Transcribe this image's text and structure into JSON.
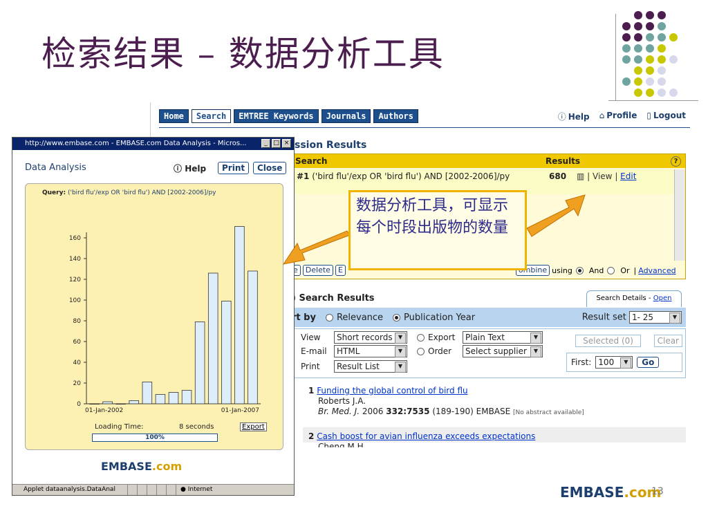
{
  "slide": {
    "title": "检索结果 – 数据分析工具",
    "callout": "数据分析工具，可显示每个时段出版物的数量",
    "brand_logo": {
      "main": "EMBASE",
      "suffix": ".com"
    },
    "page_number": "13",
    "colors": {
      "title": "#4b1e4f",
      "accent_orange": "#f0a020",
      "purple": "#4b1e4f",
      "teal": "#6fa4a0",
      "lime": "#c8c800",
      "lavender": "#d8d8ec"
    }
  },
  "main_page": {
    "nav_buttons": [
      "Home",
      "Search",
      "EMTREE Keywords",
      "Journals",
      "Authors"
    ],
    "active_nav": "Search",
    "top_links": [
      {
        "icon": "help-icon",
        "label": "Help"
      },
      {
        "icon": "profile-icon",
        "label": "Profile"
      },
      {
        "icon": "logout-icon",
        "label": "Logout"
      }
    ],
    "session_title": "ssion Results",
    "history": {
      "head_search": "Search",
      "head_results": "Results",
      "row_query_prefix": "#1",
      "row_query": "('bird flu'/exp OR 'bird flu') AND [2002-2006]/py",
      "row_count": "680",
      "row_view": "View",
      "row_edit": "Edit",
      "buttons": [
        "e",
        "Delete",
        "E",
        "ombine"
      ],
      "using_label": "using",
      "and_label": "And",
      "or_label": "Or",
      "advanced_label": "Advanced"
    },
    "results_title": ") Search Results",
    "search_details": {
      "label": "Search Details -",
      "link": "Open"
    },
    "sort": {
      "label": "rt by",
      "relevance": "Relevance",
      "pub_year": "Publication Year",
      "result_set_label": "Result set",
      "result_set_value": "1- 25"
    },
    "options": {
      "view_label": "View",
      "view_value": "Short records",
      "email_label": "E-mail",
      "email_value": "HTML",
      "print_label": "Print",
      "print_value": "Result List",
      "export_label": "Export",
      "export_value": "Plain Text",
      "order_label": "Order",
      "order_value": "Select supplier",
      "selected_label": "Selected (0)",
      "clear_label": "Clear",
      "first_label": "First:",
      "first_value": "100",
      "go_label": "Go"
    },
    "records": [
      {
        "num": "1",
        "title": "Funding the global control of bird flu",
        "authors": "Roberts J.A.",
        "journal": "Br. Med. J.",
        "year": "2006",
        "volume": "332:7535",
        "pages": "(189-190) EMBASE",
        "note": "[No abstract available]"
      },
      {
        "num": "2",
        "title": "Cash boost for avian influenza exceeds expectations",
        "authors": "Cheng M.H."
      }
    ]
  },
  "popup": {
    "window_title": "http://www.embase.com - EMBASE.com Data Analysis - Micros...",
    "heading": "Data Analysis",
    "help_label": "Help",
    "print_label": "Print",
    "close_label": "Close",
    "query_label": "Query:",
    "query_text": "('bird flu'/exp OR 'bird flu') AND [2002-2006]/py",
    "loading_label": "Loading Time:",
    "loading_value": "8 seconds",
    "export_label": "Export",
    "progress_label": "100%",
    "progress_value": 1.0,
    "logo_main": "EMBASE",
    "logo_suffix": ".com",
    "status_text": "Applet dataanalysis.DataAnal",
    "status_zone": "Internet"
  },
  "chart_data": {
    "type": "bar",
    "values": [
      0,
      2,
      0,
      3,
      21,
      9,
      11,
      13,
      79,
      126,
      99,
      171,
      128
    ],
    "ylim": [
      0,
      180
    ],
    "yticks": [
      0,
      20,
      40,
      60,
      80,
      100,
      120,
      140,
      160
    ],
    "x_tick_labels": [
      "01-Jan-2002",
      "01-Jan-2007"
    ],
    "grid": false,
    "bar_color": "#ddeefa",
    "bar_edge": "#333333"
  }
}
